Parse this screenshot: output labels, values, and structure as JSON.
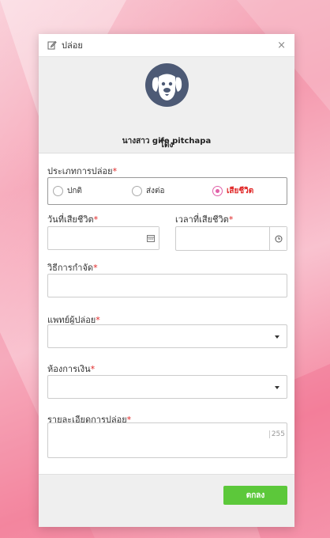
{
  "modal": {
    "title": "ปล่อย",
    "close_icon": "×"
  },
  "profile": {
    "avatar_icon": "dog-icon",
    "pet_name": "โด่ง",
    "owner_name": "นางสาว gife pitchapa"
  },
  "release_type": {
    "label": "ประเภทการปล่อย",
    "options": [
      "ปกติ",
      "ส่งต่อ",
      "เสียชีวิต"
    ],
    "selected": "เสียชีวิต"
  },
  "death_date": {
    "label": "วันที่เสียชีวิต",
    "value": "",
    "icon": "calendar-icon"
  },
  "death_time": {
    "label": "เวลาที่เสียชีวิต",
    "value": "",
    "icon": "clock-icon"
  },
  "disposal_method": {
    "label": "วิธีการกำจัด",
    "value": ""
  },
  "releasing_vet": {
    "label": "แพทย์ผู้ปล่อย",
    "value": ""
  },
  "finance_room": {
    "label": "ห้องการเงิน",
    "value": ""
  },
  "release_details": {
    "label": "รายละเอียดการปล่อย",
    "value": "",
    "counter": "255"
  },
  "required_mark": "*",
  "footer": {
    "ok_label": "ตกลง"
  },
  "colors": {
    "accent_green": "#5cc83a",
    "required_red": "#e02424",
    "radio_pink": "#e060a8",
    "avatar_bg": "#4d5a75"
  }
}
